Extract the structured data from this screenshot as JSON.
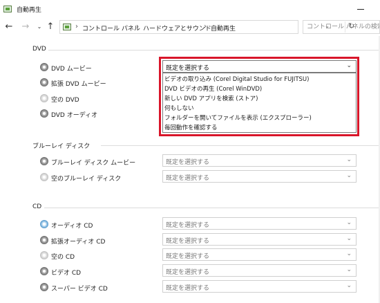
{
  "window": {
    "title": "自動再生",
    "minimize_icon": "minimize-icon"
  },
  "nav": {
    "back_icon": "arrow-left-icon",
    "forward_icon": "arrow-right-icon",
    "recent_icon": "chevron-down-icon",
    "up_icon": "arrow-up-icon",
    "breadcrumbs": [
      "コントロール パネル",
      "ハードウェアとサウンド",
      "自動再生"
    ],
    "refresh_icon": "refresh-icon",
    "search_placeholder": "コントロール パネルの検索"
  },
  "dvd": {
    "header": "DVD",
    "rows": [
      {
        "label": "DVD ムービー",
        "value": "既定を選択する",
        "icon": "dvd-disc-icon"
      },
      {
        "label": "拡張 DVD ムービー",
        "icon": "dvd-disc-icon"
      },
      {
        "label": "空の DVD",
        "icon": "blank-disc-icon"
      },
      {
        "label": "DVD オーディオ",
        "icon": "dvd-disc-icon"
      }
    ],
    "dropdown_options": [
      "ビデオの取り込み (Corel Digital Studio for FUJITSU)",
      "DVD ビデオの再生 (Corel WinDVD)",
      "新しい DVD アプリを検索 (ストア)",
      "何もしない",
      "フォルダーを開いてファイルを表示 (エクスプローラー)",
      "毎回動作を確認する"
    ]
  },
  "bluray": {
    "header": "ブルーレイ ディスク",
    "rows": [
      {
        "label": "ブルーレイ ディスク ムービー",
        "value": "既定を選択する",
        "icon": "dvd-disc-icon"
      },
      {
        "label": "空のブルーレイ ディスク",
        "value": "既定を選択する",
        "icon": "blank-disc-icon"
      }
    ]
  },
  "cd": {
    "header": "CD",
    "rows": [
      {
        "label": "オーディオ CD",
        "value": "既定を選択する",
        "icon": "audio-cd-icon"
      },
      {
        "label": "拡張オーディオ CD",
        "value": "既定を選択する",
        "icon": "dvd-disc-icon"
      },
      {
        "label": "空の CD",
        "value": "既定を選択する",
        "icon": "blank-disc-icon"
      },
      {
        "label": "ビデオ CD",
        "value": "既定を選択する",
        "icon": "dvd-disc-icon"
      },
      {
        "label": "スーパー ビデオ CD",
        "value": "既定を選択する",
        "icon": "dvd-disc-icon"
      }
    ]
  },
  "colors": {
    "highlight": "#d9162a"
  }
}
